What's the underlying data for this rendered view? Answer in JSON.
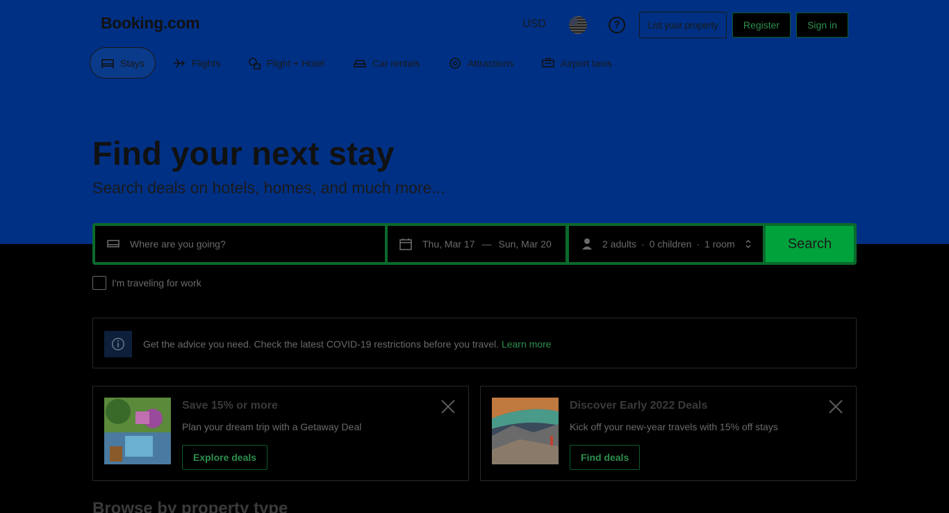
{
  "header": {
    "logo": "Booking.com",
    "currency": "USD",
    "list_property": "List your property",
    "register": "Register",
    "sign_in": "Sign in"
  },
  "nav": {
    "tabs": [
      {
        "label": "Stays",
        "icon": "bed-icon",
        "active": true
      },
      {
        "label": "Flights",
        "icon": "plane-icon"
      },
      {
        "label": "Flight + Hotel",
        "icon": "flight-hotel-icon"
      },
      {
        "label": "Car rentals",
        "icon": "car-icon"
      },
      {
        "label": "Attractions",
        "icon": "attractions-icon"
      },
      {
        "label": "Airport taxis",
        "icon": "taxi-icon"
      }
    ]
  },
  "hero": {
    "title": "Find your next stay",
    "subtitle": "Search deals on hotels, homes, and much more..."
  },
  "search": {
    "destination_placeholder": "Where are you going?",
    "checkin": "Thu, Mar 17",
    "date_separator": "—",
    "checkout": "Sun, Mar 20",
    "adults": "2 adults",
    "children": "0 children",
    "rooms": "1 room",
    "dot": "·",
    "button": "Search"
  },
  "work": {
    "label": "I'm traveling for work",
    "checked": false
  },
  "covid": {
    "text": "Get the advice you need. Check the latest COVID-19 restrictions before you travel.",
    "link": "Learn more"
  },
  "promos": [
    {
      "title": "Save 15% or more",
      "desc": "Plan your dream trip with a Getaway Deal",
      "button": "Explore deals"
    },
    {
      "title": "Discover Early 2022 Deals",
      "desc": "Kick off your new-year travels with 15% off stays",
      "button": "Find deals"
    }
  ],
  "browse_heading": "Browse by property type",
  "colors": {
    "hero_bg": "#003084",
    "accent_green": "#00a23c",
    "link_green": "#2d8f4e"
  }
}
